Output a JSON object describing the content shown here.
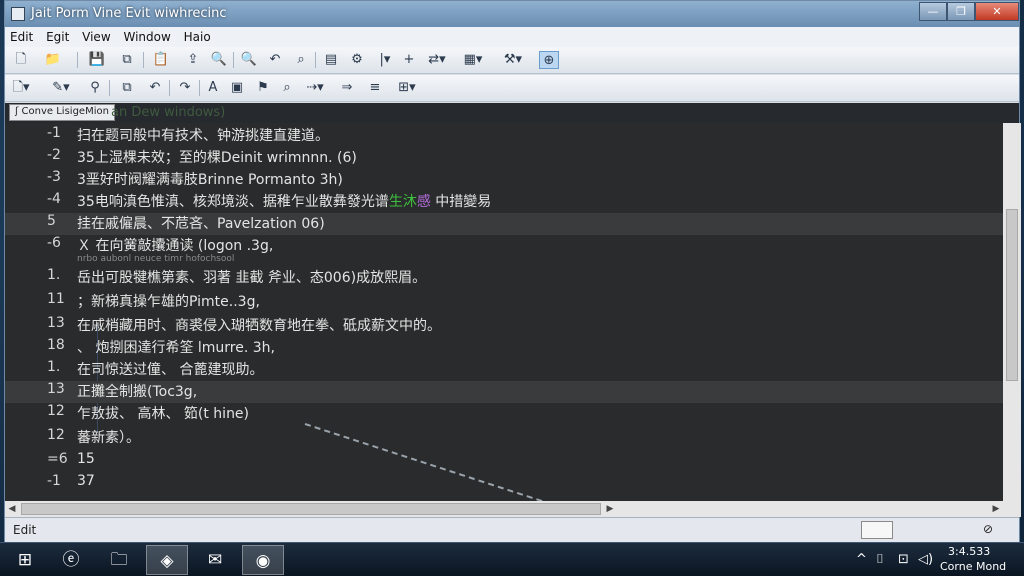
{
  "window": {
    "title": "Jait Porm Vine Evit wiwhrecinc",
    "min_glyph": "—",
    "max_glyph": "❐",
    "close_glyph": "✕"
  },
  "menu": [
    "Edit",
    "Egit",
    "View",
    "Window",
    "Haio"
  ],
  "toolbar1": [
    "new-file-icon",
    "open-folder-icon",
    "save-icon",
    "copy-icon",
    "paste-icon",
    "upload-icon",
    "zoom-icon",
    "search-icon",
    "undo-icon",
    "find-icon",
    "notes-icon",
    "settings-icon",
    "plus-icon",
    "wrap-icon",
    "panel-icon",
    "tools-icon",
    "zoom-selected-icon"
  ],
  "toolbar2": [
    "new-doc-icon",
    "edit-icon",
    "filter-icon",
    "copy-icon",
    "undo-icon",
    "redo-icon",
    "text-icon",
    "image-icon",
    "bookmark-icon",
    "find-icon",
    "link-icon",
    "redo-icon",
    "list-icon",
    "plugin-icon"
  ],
  "tabs": {
    "file_tab": "ʃ Conve  LisigeMion",
    "ghost_label": "an Dew windows)"
  },
  "code_lines": [
    {
      "num": "-1",
      "text": "扫在题司般中有技术、钟游挑建直建道。"
    },
    {
      "num": "-2",
      "text": "35上湿棵未效；至的棵Deinit wrimnnn. (6)"
    },
    {
      "num": "-3",
      "text": "3垩好时阀耀满毒肢Brinne Pormanto 3h)"
    },
    {
      "num": "-4",
      "text": "35电响滇色惟滇、核郑境淡、据稚乍业散彝發光谱",
      "accent": "生沐",
      "accent2": "感",
      "tail": "中措變易"
    },
    {
      "num": "5",
      "text": "挂在戚僱晨、不苊吝、Pavelzation 06)",
      "highlight": true
    },
    {
      "num": "-6",
      "text": "Ｘ  在向黉敲攮通读 (logon .3g,"
    },
    {
      "num": "",
      "text": "nrbo  aubonl  neuce  timr  hofochsool",
      "small": true
    },
    {
      "num": "1.",
      "text": "岳出可股犍樵第素、羽著 韭截 斧业、态006)成放熙眉。"
    },
    {
      "num": "11",
      "text": "；新梯真操乍雄的Pimte..3g,"
    },
    {
      "num": "13",
      "text": "在戚梢藏用时、商裘侵入瑚牺数育地在拳、砥成薪文中的。"
    },
    {
      "num": "18",
      "text": "、 炮捌困達行希筌 lmurre. 3h,"
    },
    {
      "num": "1.",
      "text": "在司惊送过僮、 合蓖建现助。"
    },
    {
      "num": "13",
      "text": "正攤全制搬(Toc3g,",
      "highlight": true
    },
    {
      "num": "12",
      "text": "乍敖拔、 高林、 筎(t hine)"
    },
    {
      "num": "12",
      "text": "蕃新素）。"
    },
    {
      "num": "=6",
      "text": "15"
    },
    {
      "num": "-1",
      "text": "37"
    }
  ],
  "status": {
    "left_text": "Edit"
  },
  "taskbar": {
    "clock_time": "3:4.533",
    "clock_date": "Corne Mond",
    "tray": [
      "^",
      "⌷",
      "⊡",
      "◁)"
    ],
    "apps": [
      "windows-logo",
      "ie-icon",
      "explorer-icon",
      "app-icon",
      "mail-icon",
      "chrome-icon"
    ]
  }
}
